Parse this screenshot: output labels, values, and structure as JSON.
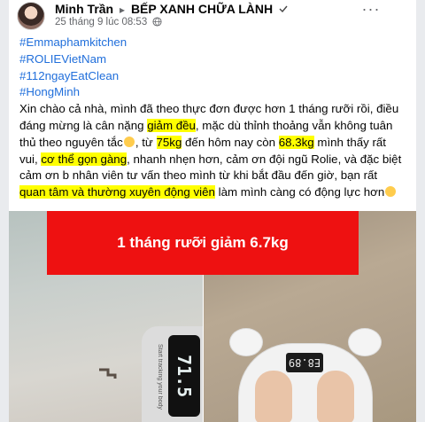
{
  "header": {
    "author": "Minh Trần",
    "separator": "▸",
    "group": "BẾP XANH CHỮA LÀNH",
    "timestamp": "25 tháng 9 lúc 08:53",
    "more_icon": "more-horizontal-icon",
    "verified_icon": "verified-badge-icon",
    "privacy_icon": "globe-icon"
  },
  "post": {
    "hashtags": [
      "#Emmaphamkitchen",
      "#ROLIEVietNam",
      "#112ngayEatClean",
      "#HongMinh"
    ],
    "p1": "Xin chào cả nhà, mình đã theo thực đơn được hơn 1 tháng rưỡi rồi, điều đáng mừng là cân nặng ",
    "h1": "giảm đều",
    "p2": ", mặc dù thỉnh thoảng vẫn không tuân thủ theo nguyên tắc",
    "p3": ", từ ",
    "h2": "75kg",
    "p4": " đến hôm nay còn ",
    "h3": "68.3kg",
    "p5": " mình thấy rất vui, ",
    "h4": "cơ thể gọn gàng",
    "p6": ", nhanh nhẹn hơn, cảm ơn đội ngũ Rolie, và đặc biệt cảm ơn b nhân viên tư vấn theo mình từ khi bắt đầu đến giờ, bạn rất ",
    "h5": "quan tâm và thường xuyên động viên",
    "p7": " làm mình càng có động lực hơn"
  },
  "photos": {
    "banner_text": "1 tháng rưỡi giảm 6.7kg",
    "left_readout": "71.5",
    "right_readout": "E8.89",
    "left_scale_text": "Start tracking your body"
  },
  "colors": {
    "hashtag": "#216fdb",
    "highlight": "#ffff00",
    "banner": "#ee1111",
    "meta": "#65676b"
  }
}
